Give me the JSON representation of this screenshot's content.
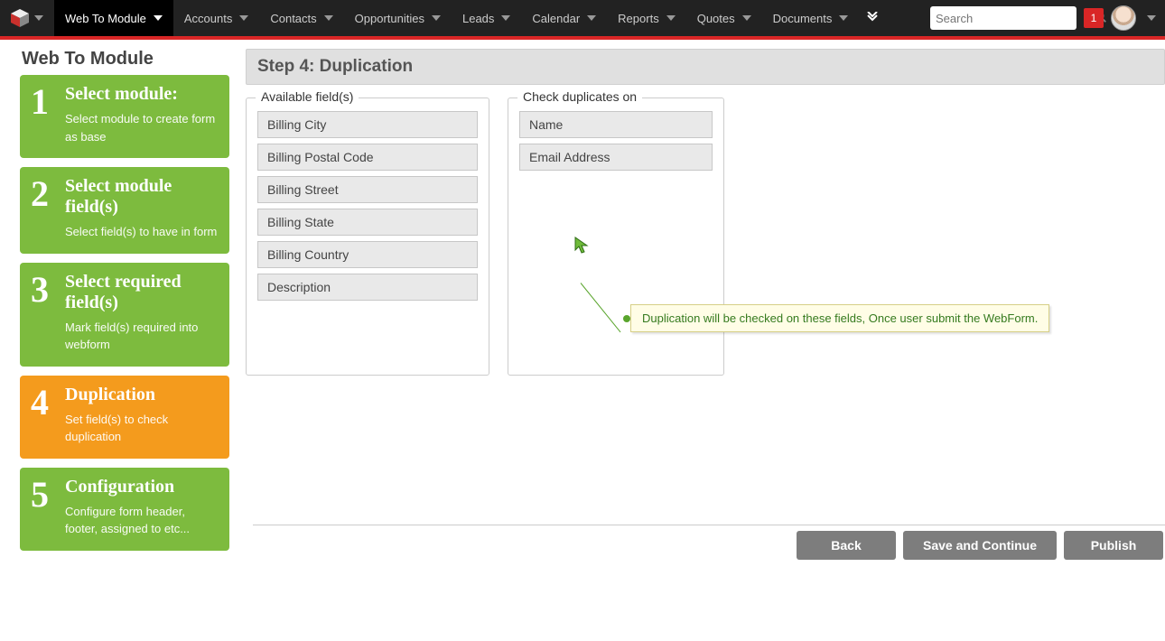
{
  "nav": {
    "active": "Web To Module",
    "items": [
      "Web To Module",
      "Accounts",
      "Contacts",
      "Opportunities",
      "Leads",
      "Calendar",
      "Reports",
      "Quotes",
      "Documents"
    ],
    "search_placeholder": "Search",
    "notif_count": "1"
  },
  "page_title": "Web To Module",
  "steps": [
    {
      "n": "1",
      "title": "Select module:",
      "sub": "Select module to create form as base",
      "active": false
    },
    {
      "n": "2",
      "title": "Select module field(s)",
      "sub": "Select field(s) to have in form",
      "active": false
    },
    {
      "n": "3",
      "title": "Select required field(s)",
      "sub": "Mark field(s) required into webform",
      "active": false
    },
    {
      "n": "4",
      "title": "Duplication",
      "sub": "Set field(s) to check duplication",
      "active": true
    },
    {
      "n": "5",
      "title": "Configuration",
      "sub": "Configure form header, footer, assigned to etc...",
      "active": false
    }
  ],
  "main_header": "Step 4: Duplication",
  "available_legend": "Available field(s)",
  "duplicate_legend": "Check duplicates on",
  "available_fields": [
    "Billing City",
    "Billing Postal Code",
    "Billing Street",
    "Billing State",
    "Billing Country",
    "Description"
  ],
  "duplicate_fields": [
    "Name",
    "Email Address"
  ],
  "annotation": "Duplication will be checked on these fields, Once user submit the WebForm.",
  "buttons": {
    "back": "Back",
    "save": "Save and Continue",
    "publish": "Publish"
  }
}
